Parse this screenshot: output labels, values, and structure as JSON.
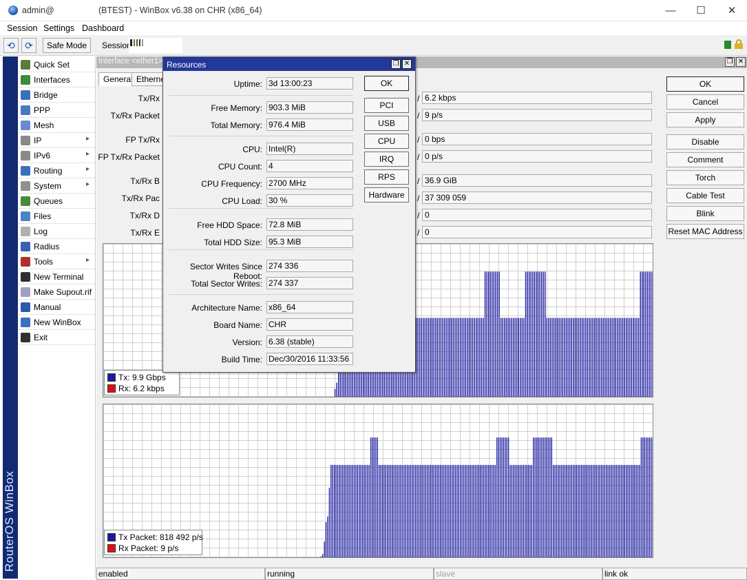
{
  "window": {
    "user": "admin@",
    "title": "(BTEST) - WinBox v6.38 on CHR (x86_64)",
    "min": "—",
    "max": "☐",
    "close": "✕"
  },
  "menu": [
    "Session",
    "Settings",
    "Dashboard"
  ],
  "toolbar": {
    "undo": "⟲",
    "redo": "⟳",
    "safe_mode": "Safe Mode",
    "session_label": "Session:"
  },
  "banner": "RouterOS WinBox",
  "sidebar": {
    "items": [
      {
        "label": "Quick Set",
        "icon": "quick-set-icon",
        "color": "#5a7c3a",
        "arrow": ""
      },
      {
        "label": "Interfaces",
        "icon": "interfaces-icon",
        "color": "#3d8a3d",
        "arrow": ""
      },
      {
        "label": "Bridge",
        "icon": "bridge-icon",
        "color": "#3a6fbf",
        "arrow": ""
      },
      {
        "label": "PPP",
        "icon": "ppp-icon",
        "color": "#4a78c0",
        "arrow": ""
      },
      {
        "label": "Mesh",
        "icon": "mesh-icon",
        "color": "#6a8ad0",
        "arrow": ""
      },
      {
        "label": "IP",
        "icon": "ip-icon",
        "color": "#8a8a8a",
        "arrow": "▸"
      },
      {
        "label": "IPv6",
        "icon": "ipv6-icon",
        "color": "#8a8a8a",
        "arrow": "▸"
      },
      {
        "label": "Routing",
        "icon": "routing-icon",
        "color": "#3a6fbf",
        "arrow": "▸"
      },
      {
        "label": "System",
        "icon": "system-gear-icon",
        "color": "#909090",
        "arrow": "▸"
      },
      {
        "label": "Queues",
        "icon": "queues-icon",
        "color": "#4a8a3a",
        "arrow": ""
      },
      {
        "label": "Files",
        "icon": "files-folder-icon",
        "color": "#4a84c8",
        "arrow": ""
      },
      {
        "label": "Log",
        "icon": "log-icon",
        "color": "#b0b0b0",
        "arrow": ""
      },
      {
        "label": "Radius",
        "icon": "radius-icon",
        "color": "#3a60b0",
        "arrow": ""
      },
      {
        "label": "Tools",
        "icon": "tools-icon",
        "color": "#b03030",
        "arrow": "▸"
      },
      {
        "label": "New Terminal",
        "icon": "terminal-icon",
        "color": "#303030",
        "arrow": ""
      },
      {
        "label": "Make Supout.rif",
        "icon": "supout-icon",
        "color": "#a0a0c0",
        "arrow": ""
      },
      {
        "label": "Manual",
        "icon": "manual-help-icon",
        "color": "#2a5ab0",
        "arrow": ""
      },
      {
        "label": "New WinBox",
        "icon": "new-winbox-icon",
        "color": "#3a70c0",
        "arrow": ""
      },
      {
        "label": "Exit",
        "icon": "exit-icon",
        "color": "#303030",
        "arrow": ""
      }
    ]
  },
  "interface": {
    "title": "Interface <ether1>",
    "tabs": [
      "General",
      "Ethernet"
    ],
    "fields": [
      {
        "label": "Tx/Rx",
        "value": "6.2 kbps"
      },
      {
        "label": "Tx/Rx Packet",
        "value": "9 p/s"
      },
      {
        "label": "FP Tx/Rx",
        "value": "0 bps"
      },
      {
        "label": "FP Tx/Rx Packet",
        "value": "0 p/s"
      },
      {
        "label": "Tx/Rx B",
        "value": "36.9 GiB"
      },
      {
        "label": "Tx/Rx Pac",
        "value": "37 309 059"
      },
      {
        "label": "Tx/Rx D",
        "value": "0"
      },
      {
        "label": "Tx/Rx E",
        "value": "0"
      }
    ],
    "slash": "/",
    "buttons": [
      "OK",
      "Cancel",
      "Apply",
      "Disable",
      "Comment",
      "Torch",
      "Cable Test",
      "Blink",
      "Reset MAC Address"
    ],
    "legend1": {
      "tx": "Tx:  9.9 Gbps",
      "rx": "Rx:  6.2 kbps"
    },
    "legend2": {
      "tx": "Tx Packet:  818 492 p/s",
      "rx": "Rx Packet:  9 p/s"
    },
    "status": [
      "enabled",
      "running",
      "slave",
      "link ok"
    ]
  },
  "chart_data": [
    {
      "type": "bar",
      "series": [
        {
          "name": "Tx",
          "unit": "Gbps",
          "color": "#1a1aa0",
          "values": [
            0,
            0,
            0,
            0,
            0,
            0,
            0,
            0,
            0,
            0,
            0,
            0,
            0,
            0,
            0,
            0,
            0,
            0,
            0,
            0,
            0,
            0,
            0,
            0,
            0,
            0,
            0,
            0,
            0,
            0,
            0,
            0,
            0,
            0,
            0,
            0,
            0,
            0,
            0,
            0,
            0,
            0,
            0,
            0,
            0,
            0,
            0,
            0,
            0,
            0,
            0,
            0,
            0,
            0,
            0,
            0,
            0,
            0,
            0,
            0,
            0,
            0,
            0,
            0,
            0,
            0,
            0,
            0,
            0,
            0,
            0,
            0,
            0,
            0,
            0,
            0,
            0,
            0,
            0,
            0,
            0,
            0,
            0,
            0,
            0,
            0,
            0,
            0,
            0,
            0,
            0,
            0,
            0,
            0,
            0,
            0,
            0,
            0,
            0,
            0,
            0,
            0,
            0,
            0,
            0,
            0,
            0,
            0,
            0,
            0,
            0,
            0,
            0,
            0,
            0,
            0,
            0,
            0,
            0,
            0,
            0,
            0,
            0,
            0,
            0,
            0,
            0,
            0,
            0,
            0,
            0,
            0.3,
            0.5,
            1.5,
            2.3,
            2.3,
            2.4,
            2.4,
            2.4,
            2.4,
            2.4,
            2.4,
            2.5,
            2.5,
            2.5,
            2.5,
            2.5,
            2.6,
            2.6,
            2.6,
            2.6,
            2.6,
            2.6,
            2.6,
            2.6,
            2.6,
            2.6,
            2.6,
            2.6,
            2.6,
            2.6,
            2.6,
            2.6,
            2.6,
            2.6,
            2.6,
            2.6,
            2.6,
            2.6,
            2.6,
            2.6,
            2.6,
            2.6,
            2.6,
            2.6,
            2.6,
            2.6,
            2.6,
            2.6,
            2.6,
            2.6,
            2.6,
            2.6,
            2.6,
            2.6,
            2.6,
            2.6,
            2.6,
            2.6,
            2.6,
            2.6,
            2.6,
            2.6,
            2.6,
            2.6,
            2.6,
            2.6,
            2.6,
            2.6,
            2.6,
            2.6,
            2.6,
            2.6,
            2.6,
            2.6,
            2.6,
            2.6,
            2.6,
            2.6,
            2.6,
            2.6,
            2.6,
            2.6,
            2.6,
            2.6,
            2.6,
            4.1,
            4.1,
            4.1,
            4.1,
            4.1,
            4.1,
            4.1,
            4.1,
            4.1,
            2.6,
            2.6,
            2.6,
            2.6,
            2.6,
            2.6,
            2.6,
            2.6,
            2.6,
            2.6,
            2.6,
            2.6,
            2.6,
            2.6,
            4.1,
            4.1,
            4.1,
            4.1,
            4.1,
            4.1,
            4.1,
            4.1,
            4.1,
            4.1,
            4.1,
            4.1,
            2.6,
            2.6,
            2.6,
            2.6,
            2.6,
            2.6,
            2.6,
            2.6,
            2.6,
            2.6,
            2.6,
            2.6,
            2.6,
            2.6,
            2.6,
            2.6,
            2.6,
            2.6,
            2.6,
            2.6,
            2.6,
            2.6,
            2.6,
            2.6,
            2.6,
            2.6,
            2.6,
            2.6,
            2.6,
            2.6,
            2.6,
            2.6,
            2.6,
            2.6,
            2.6,
            2.6,
            2.6,
            2.6,
            2.6,
            2.6,
            2.6,
            2.6,
            2.6,
            2.6,
            2.6,
            2.6,
            2.6,
            2.6,
            2.6,
            2.6,
            2.6,
            2.6,
            2.6,
            4.1,
            4.1,
            4.1,
            4.1,
            4.1,
            4.1,
            4.1,
            4.1
          ]
        },
        {
          "name": "Rx",
          "unit": "kbps",
          "color": "#e01010",
          "values": []
        }
      ]
    },
    {
      "type": "bar",
      "series": [
        {
          "name": "Tx Packet",
          "unit": "p/s",
          "color": "#1a1aa0",
          "values": [
            0,
            0,
            0,
            0,
            0,
            0,
            0,
            0,
            0,
            0,
            0,
            0,
            0,
            0,
            0,
            0,
            0,
            0,
            0,
            0,
            0,
            0,
            0,
            0,
            0,
            0,
            0,
            0,
            0,
            0,
            0,
            0,
            0,
            0,
            0,
            0,
            0,
            0,
            0,
            0,
            0,
            0,
            0,
            0,
            0,
            0,
            0,
            0,
            0,
            0,
            0,
            0,
            0,
            0,
            0,
            0,
            0,
            0,
            0,
            0,
            0,
            0,
            0,
            0,
            0,
            0,
            0,
            0,
            0,
            0,
            0,
            0,
            0,
            0,
            0,
            0,
            0,
            0,
            0,
            0,
            0,
            0,
            0,
            0,
            0,
            0,
            0,
            0,
            0,
            0,
            0,
            0,
            0,
            0,
            0,
            0,
            0,
            0,
            0,
            0,
            0,
            0,
            0,
            0,
            0,
            0,
            0,
            0,
            0,
            0,
            0,
            0,
            0,
            0,
            0,
            0,
            0,
            0,
            0,
            0,
            0,
            0,
            0,
            0,
            0,
            0,
            0,
            0,
            0,
            0,
            0,
            0.2,
            0.4,
            1.5,
            3.2,
            3.7,
            6.2,
            8.2,
            8.2,
            8.2,
            8.2,
            8.2,
            8.2,
            8.2,
            8.2,
            8.2,
            8.2,
            8.2,
            8.2,
            8.2,
            8.2,
            8.2,
            8.2,
            8.2,
            8.2,
            8.2,
            8.2,
            8.2,
            8.2,
            8.2,
            8.2,
            10.6,
            10.6,
            10.6,
            10.6,
            10.6,
            8.2,
            8.2,
            8.2,
            8.2,
            8.2,
            8.2,
            8.2,
            8.2,
            8.2,
            8.2,
            8.2,
            8.2,
            8.2,
            8.2,
            8.2,
            8.2,
            8.2,
            8.2,
            8.2,
            8.2,
            8.2,
            8.2,
            8.2,
            8.2,
            8.2,
            8.2,
            8.2,
            8.2,
            8.2,
            8.2,
            8.2,
            8.2,
            8.2,
            8.2,
            8.2,
            8.2,
            8.2,
            8.2,
            8.2,
            8.2,
            8.2,
            8.2,
            8.2,
            8.2,
            8.2,
            8.2,
            8.2,
            8.2,
            8.2,
            8.2,
            8.2,
            8.2,
            8.2,
            8.2,
            8.2,
            8.2,
            8.2,
            8.2,
            8.2,
            8.2,
            8.2,
            8.2,
            8.2,
            8.2,
            8.2,
            8.2,
            8.2,
            8.2,
            8.2,
            8.2,
            8.2,
            10.6,
            10.6,
            10.6,
            10.6,
            10.6,
            10.6,
            10.6,
            10.6,
            8.2,
            8.2,
            8.2,
            8.2,
            8.2,
            8.2,
            8.2,
            8.2,
            8.2,
            8.2,
            8.2,
            8.2,
            8.2,
            8.2,
            10.6,
            10.6,
            10.6,
            10.6,
            10.6,
            10.6,
            10.6,
            10.6,
            10.6,
            10.6,
            10.6,
            10.6,
            8.2,
            8.2,
            8.2,
            8.2,
            8.2,
            8.2,
            8.2,
            8.2,
            8.2,
            8.2,
            8.2,
            8.2,
            8.2,
            8.2,
            8.2,
            8.2,
            8.2,
            8.2,
            8.2,
            8.2,
            8.2,
            8.2,
            8.2,
            8.2,
            8.2,
            8.2,
            8.2,
            8.2,
            8.2,
            8.2,
            8.2,
            8.2,
            8.2,
            8.2,
            8.2,
            8.2,
            8.2,
            8.2,
            8.2,
            8.2,
            8.2,
            8.2,
            8.2,
            8.2,
            8.2,
            8.2,
            8.2,
            8.2,
            8.2,
            8.2,
            8.2,
            8.2,
            8.2,
            10.6,
            10.6,
            10.6,
            10.6,
            10.6,
            10.6,
            10.6,
            10.6
          ]
        },
        {
          "name": "Rx Packet",
          "unit": "p/s",
          "color": "#e01010",
          "values": []
        }
      ]
    }
  ],
  "resources": {
    "title": "Resources",
    "fields": [
      {
        "label": "Uptime:",
        "value": "3d 13:00:23"
      },
      {
        "label": "Free Memory:",
        "value": "903.3 MiB"
      },
      {
        "label": "Total Memory:",
        "value": "976.4 MiB"
      },
      {
        "label": "CPU:",
        "value": "Intel(R)"
      },
      {
        "label": "CPU Count:",
        "value": "4"
      },
      {
        "label": "CPU Frequency:",
        "value": "2700 MHz"
      },
      {
        "label": "CPU Load:",
        "value": "30 %"
      },
      {
        "label": "Free HDD Space:",
        "value": "72.8 MiB"
      },
      {
        "label": "Total HDD Size:",
        "value": "95.3 MiB"
      },
      {
        "label": "Sector Writes Since Reboot:",
        "value": "274 336"
      },
      {
        "label": "Total Sector Writes:",
        "value": "274 337"
      },
      {
        "label": "Architecture Name:",
        "value": "x86_64"
      },
      {
        "label": "Board Name:",
        "value": "CHR"
      },
      {
        "label": "Version:",
        "value": "6.38 (stable)"
      },
      {
        "label": "Build Time:",
        "value": "Dec/30/2016 11:33:56"
      }
    ],
    "buttons": [
      "OK",
      "PCI",
      "USB",
      "CPU",
      "IRQ",
      "RPS",
      "Hardware"
    ]
  },
  "colors": {
    "banner": "#122a72",
    "dialog_header": "#23389a",
    "tx": "#1a1aa0",
    "rx": "#e01010"
  }
}
